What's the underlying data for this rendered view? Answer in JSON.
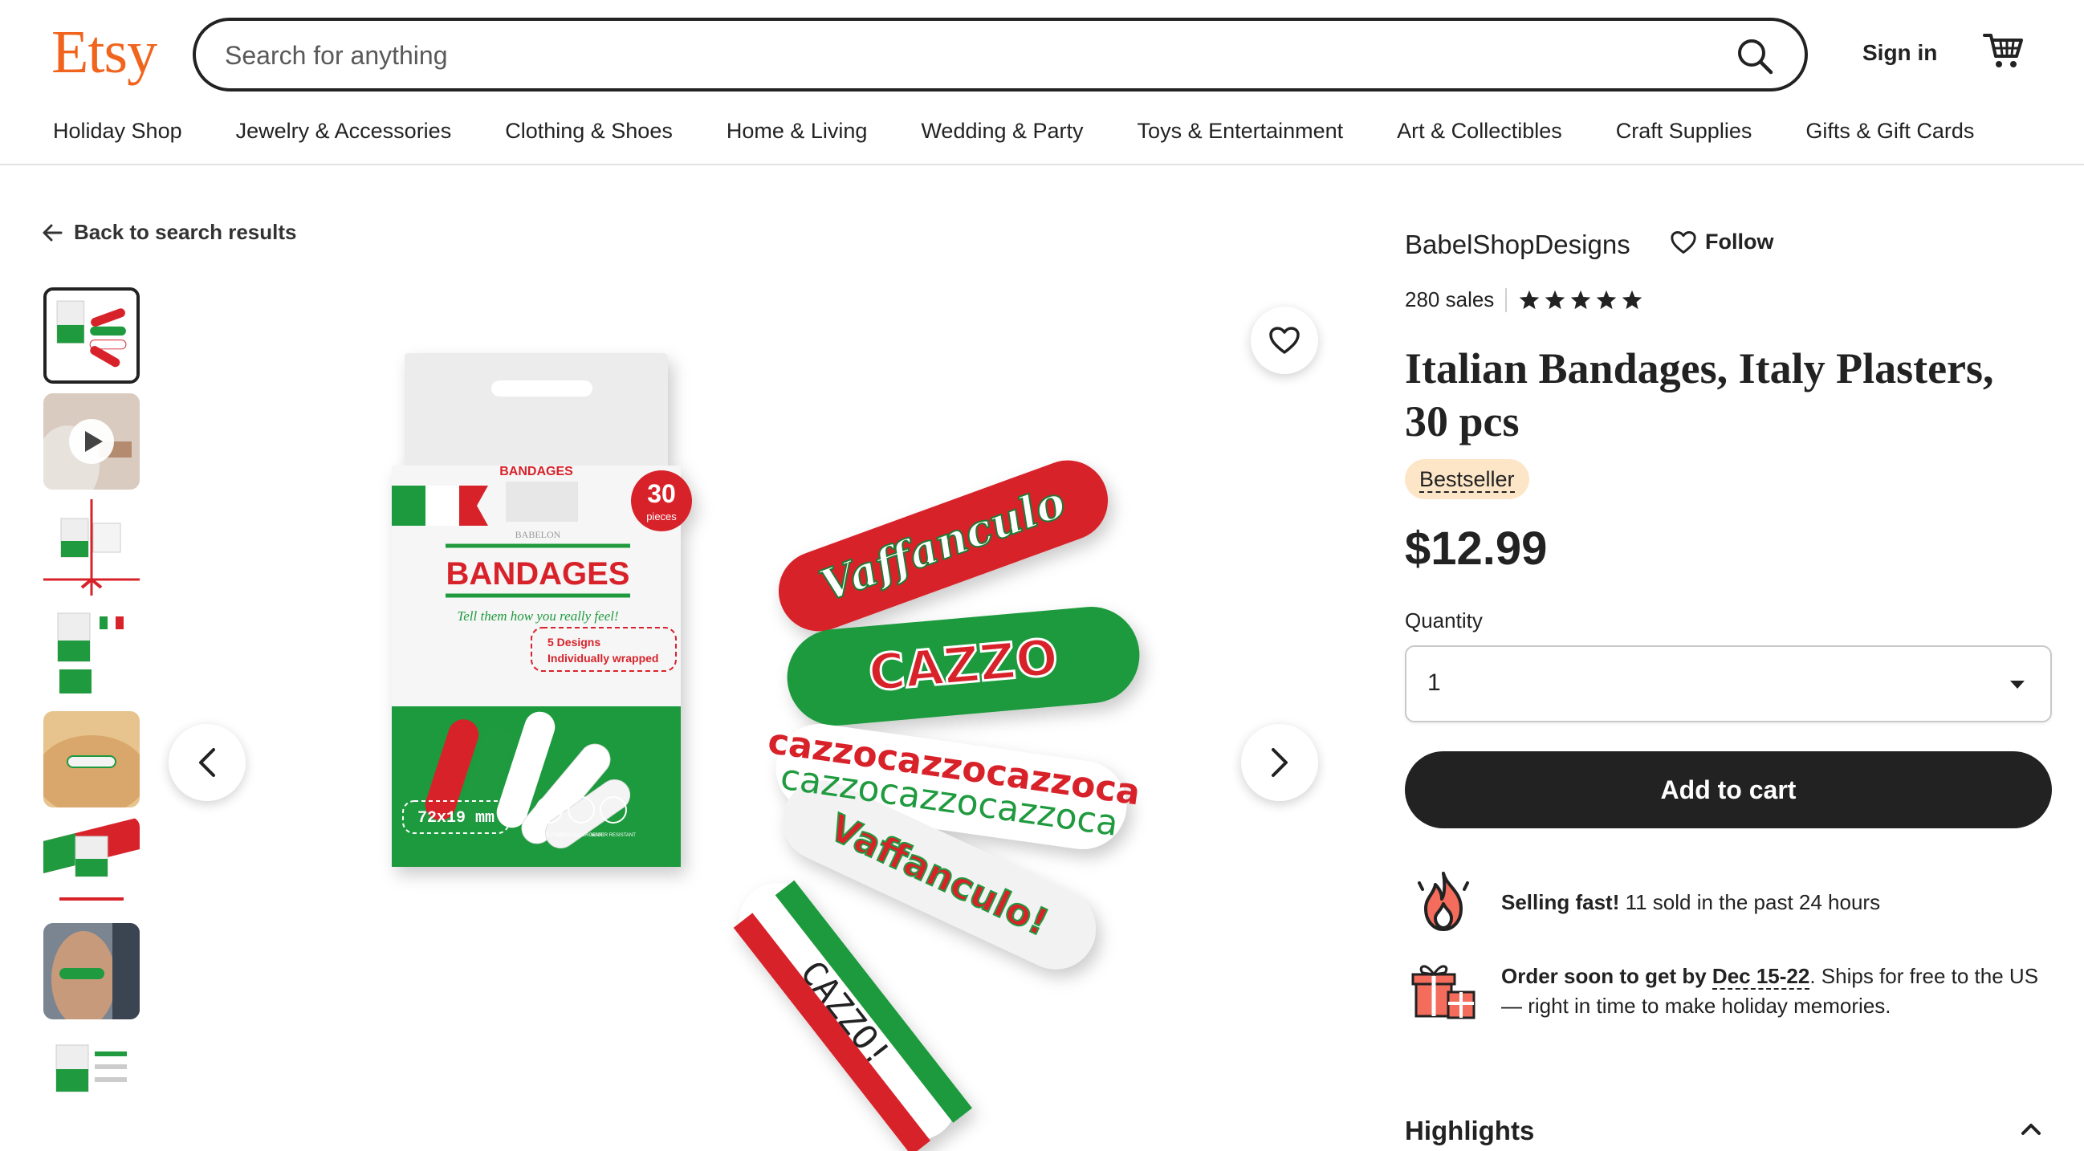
{
  "header": {
    "logo": "Etsy",
    "search_placeholder": "Search for anything",
    "sign_in": "Sign in",
    "categories": [
      "Holiday Shop",
      "Jewelry & Accessories",
      "Clothing & Shoes",
      "Home & Living",
      "Wedding & Party",
      "Toys & Entertainment",
      "Art & Collectibles",
      "Craft Supplies",
      "Gifts & Gift Cards"
    ]
  },
  "gallery": {
    "back_label": "Back to search results",
    "thumbnail_count": 8,
    "active_index": 0,
    "video_thumbnail_index": 1
  },
  "product_image": {
    "box_title": "BANDAGES",
    "box_tagline": "Tell them how you really feel!",
    "box_count": "30",
    "box_count_unit": "pieces",
    "box_features": [
      "5 Designs",
      "Individually wrapped"
    ],
    "box_size": "72x19 mm",
    "box_icons": [
      "LATEX FREE",
      "HYPO-ALLERGENIC",
      "WATER RESISTANT"
    ],
    "box_brand": "BABELON",
    "strip_words": [
      "Vaffanculo",
      "CAZZO",
      "cazzocazzocazzoca",
      "Vaffanculo!",
      "CAZZO!"
    ]
  },
  "shop": {
    "name": "BabelShopDesigns",
    "follow_label": "Follow",
    "sales": "280 sales",
    "rating_stars": 5
  },
  "listing": {
    "title": "Italian Bandages, Italy Plasters, 30 pcs",
    "badge": "Bestseller",
    "price": "$12.99",
    "quantity_label": "Quantity",
    "quantity_value": "1",
    "add_to_cart": "Add to cart",
    "selling_fast_bold": "Selling fast!",
    "selling_fast_text": " 11 sold in the past 24 hours",
    "order_soon_bold": "Order soon to get by ",
    "order_date": "Dec 15-22",
    "order_rest": ". Ships for free to the US — right in time to make holiday memories.",
    "highlights": "Highlights"
  },
  "colors": {
    "brand_orange": "#f1641e",
    "italy_green": "#1f9a3e",
    "italy_red": "#d8222a",
    "badge_bg": "#fde6c8",
    "button_black": "#222222"
  }
}
